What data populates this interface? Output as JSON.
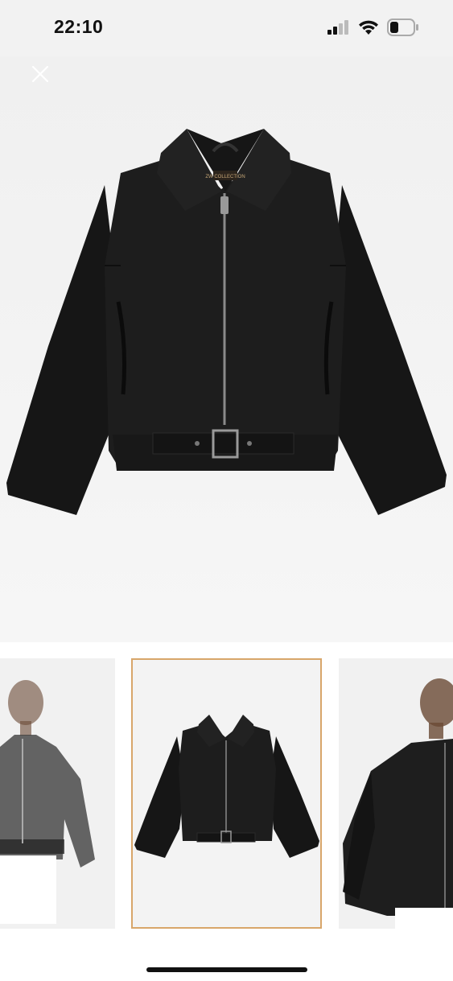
{
  "status_bar": {
    "time": "22:10",
    "icons": [
      "cellular-signal-icon",
      "wifi-icon",
      "battery-icon"
    ]
  },
  "toolbar": {
    "close_icon": "close-icon"
  },
  "hero": {
    "alt": "black leather bomber jacket product photo",
    "jacket_label": "ZW COLLECTION"
  },
  "thumbnails": [
    {
      "name": "model-front-thumbnail",
      "selected": false
    },
    {
      "name": "jacket-flat-thumbnail",
      "selected": true
    },
    {
      "name": "model-side-thumbnail",
      "selected": false
    }
  ],
  "colors": {
    "accent_selected_border": "#d8a66a",
    "jacket": "#1c1c1c",
    "background": "#f2f2f2"
  }
}
